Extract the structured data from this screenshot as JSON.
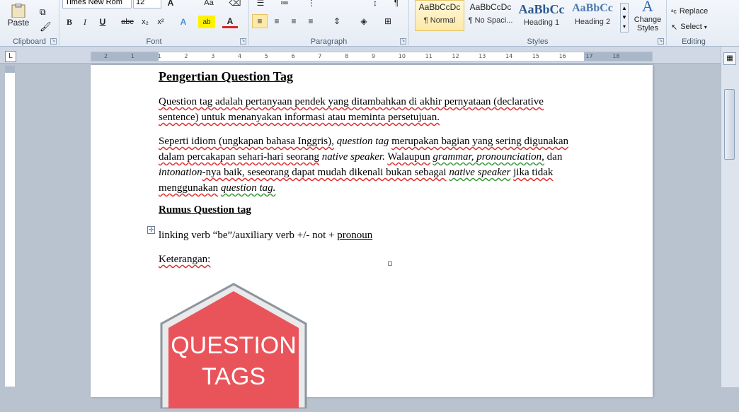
{
  "ribbon": {
    "clipboard": {
      "label": "Clipboard",
      "paste": "Paste"
    },
    "font": {
      "label": "Font",
      "family": "Times New Rom",
      "size": "12",
      "bold": "B",
      "italic": "I",
      "underline": "U",
      "strike": "abc",
      "subscript": "x₂",
      "superscript": "x²",
      "grow": "A",
      "aa": "Aa"
    },
    "paragraph": {
      "label": "Paragraph"
    },
    "styles": {
      "label": "Styles",
      "items": [
        {
          "sample": "AaBbCcDc",
          "name": "¶ Normal"
        },
        {
          "sample": "AaBbCcDc",
          "name": "¶ No Spaci..."
        },
        {
          "sample": "AaBbCc",
          "name": "Heading 1"
        },
        {
          "sample": "AaBbCc",
          "name": "Heading 2"
        }
      ],
      "change_styles": "Change Styles"
    },
    "editing": {
      "label": "Editing",
      "replace": "Replace",
      "select": "Select"
    }
  },
  "ruler": {
    "ticks": [
      "2",
      "1",
      "1",
      "2",
      "3",
      "4",
      "5",
      "6",
      "7",
      "8",
      "9",
      "10",
      "11",
      "12",
      "13",
      "14",
      "15",
      "16",
      "17",
      "18"
    ]
  },
  "document": {
    "title": "Pengertian Question Tag",
    "p1": "Question tag adalah pertanyaan pendek yang ditambahkan di akhir pernyataan (declarative sentence) untuk menanyakan informasi atau meminta persetujuan.",
    "p2a": "Seperti idiom (ungkapan bahasa Inggris),",
    "p2b": "question tag",
    "p2c": "merupakan bagian yang sering digunakan dalam percakapan sehari-hari seorang",
    "p2d": "native speaker.",
    "p2e": "Walaupun",
    "p2f": "grammar, pronounciation,",
    "p2g": "dan",
    "p2h": "intonation",
    "p2i": "-nya baik, seseorang dapat mudah dikenali bukan sebagai",
    "p2j": "native speaker",
    "p2k": "jika tidak menggunakan",
    "p2l": "question tag.",
    "h2": "Rumus Question tag",
    "formula": "linking verb “be”/auxiliary verb +/- not +",
    "formula_pronoun": "pronoun",
    "keterangan": "Keterangan:",
    "sign_line1": "QUESTION",
    "sign_line2": "TAGS"
  },
  "colors": {
    "sign_fill": "#e9545b",
    "sign_border": "#9aa0a6"
  }
}
